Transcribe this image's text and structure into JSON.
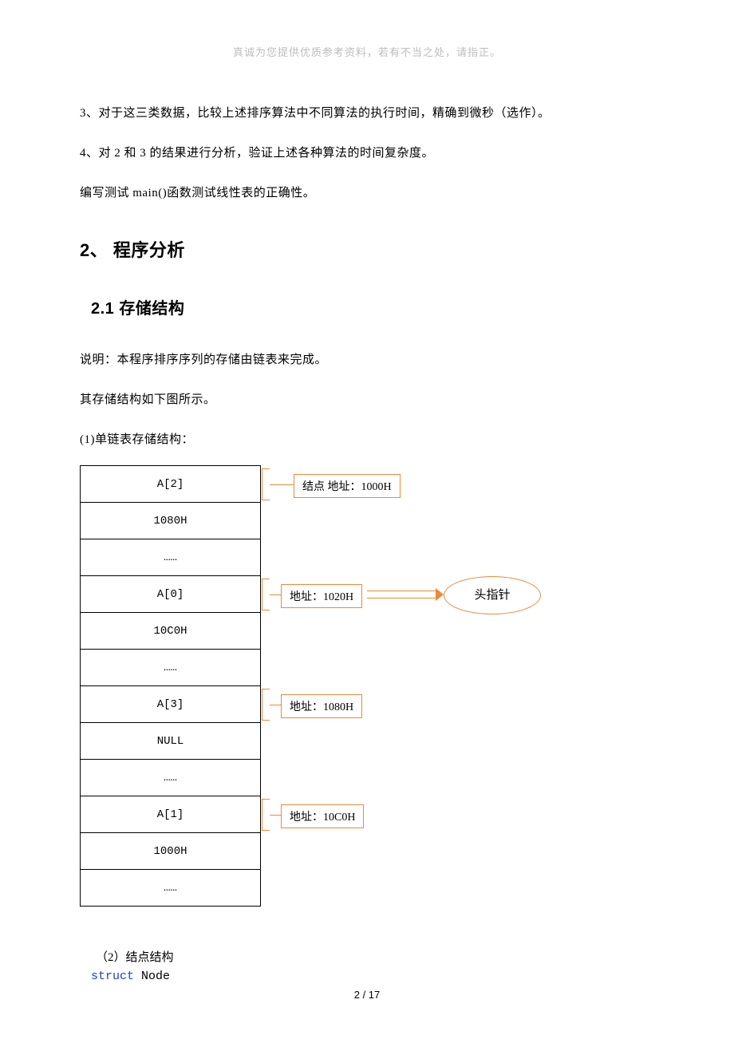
{
  "header_note": "真诚为您提供优质参考资料，若有不当之处，请指正。",
  "para1": "3、对于这三类数据，比较上述排序算法中不同算法的执行时间，精确到微秒（选作）。",
  "para2": "4、对 2 和 3 的结果进行分析，验证上述各种算法的时间复杂度。",
  "para3": "编写测试 main()函数测试线性表的正确性。",
  "h2": "2、 程序分析",
  "h3": "2.1 存储结构",
  "desc1": "说明：本程序排序序列的存储由链表来完成。",
  "desc2": "其存储结构如下图所示。",
  "diag_caption": "(1)单链表存储结构：",
  "mem": {
    "r0": "A[2]",
    "r1": "1080H",
    "r2": "……",
    "r3": "A[0]",
    "r4": "10C0H",
    "r5": "……",
    "r6": "A[3]",
    "r7": "NULL",
    "r8": "……",
    "r9": "A[1]",
    "r10": "1000H",
    "r11": "……"
  },
  "labels": {
    "l0": "结点 地址：1000H",
    "l1": "地址：1020H",
    "l2": "地址：1080H",
    "l3": "地址：10C0H",
    "head": "头指针"
  },
  "sub2": "（2）结点结构",
  "code_kw": "struct",
  "code_ident": " Node",
  "footer": "2 / 17"
}
